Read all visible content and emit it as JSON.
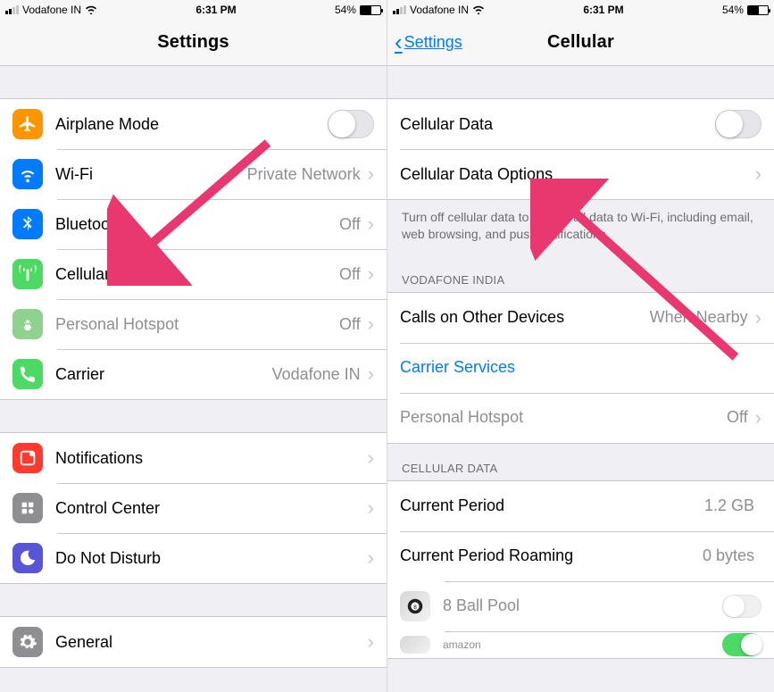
{
  "status": {
    "carrier": "Vodafone IN",
    "time": "6:31 PM",
    "battery": "54%"
  },
  "left": {
    "title": "Settings",
    "rows1": [
      {
        "label": "Airplane Mode",
        "value": "",
        "type": "switch",
        "on": false
      },
      {
        "label": "Wi-Fi",
        "value": "Private Network",
        "type": "link"
      },
      {
        "label": "Bluetooth",
        "value": "Off",
        "type": "link"
      },
      {
        "label": "Cellular",
        "value": "Off",
        "type": "link"
      },
      {
        "label": "Personal Hotspot",
        "value": "Off",
        "type": "link",
        "muted": true
      },
      {
        "label": "Carrier",
        "value": "Vodafone IN",
        "type": "link"
      }
    ],
    "rows2": [
      {
        "label": "Notifications"
      },
      {
        "label": "Control Center"
      },
      {
        "label": "Do Not Disturb"
      }
    ],
    "rows3": [
      {
        "label": "General"
      }
    ]
  },
  "right": {
    "back": "Settings",
    "title": "Cellular",
    "cellularData": "Cellular Data",
    "cellularDataOptions": "Cellular Data Options",
    "helperText": "Turn off cellular data to restrict all data to Wi-Fi, including email, web browsing, and push notifications.",
    "vodafoneHeader": "VODAFONE INDIA",
    "callsOther": {
      "label": "Calls on Other Devices",
      "value": "When Nearby"
    },
    "carrierServices": "Carrier Services",
    "personalHotspot": {
      "label": "Personal Hotspot",
      "value": "Off"
    },
    "cellHeader": "CELLULAR DATA",
    "period": {
      "label": "Current Period",
      "value": "1.2 GB"
    },
    "roaming": {
      "label": "Current Period Roaming",
      "value": "0 bytes"
    },
    "app1": "8 Ball Pool",
    "app2": "amazon"
  }
}
